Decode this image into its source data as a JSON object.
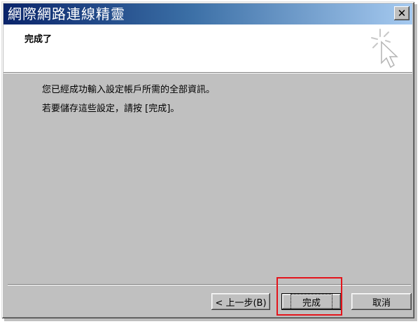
{
  "window": {
    "title": "網際網路連線精靈",
    "close_label": "✕"
  },
  "header": {
    "title": "完成了",
    "icon": "wizard-sparkle-cursor-icon"
  },
  "body": {
    "line1": "您已經成功輸入設定帳戶所需的全部資訊。",
    "line2": "若要儲存這些設定，請按 [完成]。"
  },
  "buttons": {
    "back": "< 上一步(B)",
    "finish": "完成",
    "cancel": "取消"
  },
  "colors": {
    "title_gradient_start": "#0a246a",
    "title_gradient_end": "#a6caf0",
    "highlight": "#e3141b",
    "dialog_face": "#c0c0c0"
  }
}
